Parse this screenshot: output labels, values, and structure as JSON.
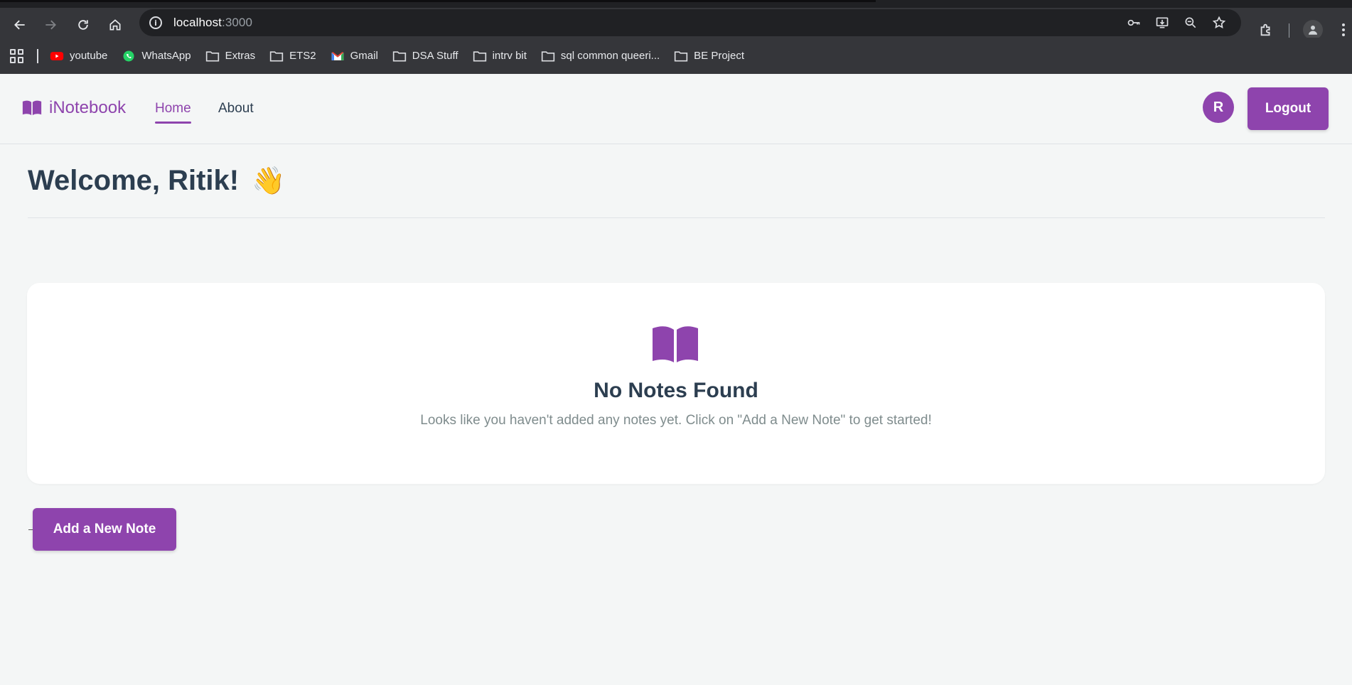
{
  "browser": {
    "url_host": "localhost",
    "url_port": ":3000",
    "bookmarks": [
      {
        "label": "youtube",
        "icon": "youtube-icon"
      },
      {
        "label": "WhatsApp",
        "icon": "whatsapp-icon"
      },
      {
        "label": "Extras",
        "icon": "folder-icon"
      },
      {
        "label": "ETS2",
        "icon": "folder-icon"
      },
      {
        "label": "Gmail",
        "icon": "gmail-icon"
      },
      {
        "label": "DSA Stuff",
        "icon": "folder-icon"
      },
      {
        "label": "intrv bit",
        "icon": "folder-icon"
      },
      {
        "label": "sql common queeri...",
        "icon": "folder-icon"
      },
      {
        "label": "BE Project",
        "icon": "folder-icon"
      }
    ]
  },
  "navbar": {
    "brand": "iNotebook",
    "links": [
      {
        "label": "Home",
        "active": true
      },
      {
        "label": "About",
        "active": false
      }
    ],
    "avatar_initial": "R",
    "logout_label": "Logout"
  },
  "main": {
    "welcome": "Welcome, Ritik!",
    "wave_emoji": "👋",
    "empty_title": "No Notes Found",
    "empty_text": "Looks like you haven't added any notes yet. Click on \"Add a New Note\" to get started!",
    "add_button_label": "Add a New Note"
  },
  "colors": {
    "accent": "#8e44ad",
    "heading": "#2c3e50",
    "muted": "#7f8c8d",
    "background": "#f4f6f6"
  }
}
